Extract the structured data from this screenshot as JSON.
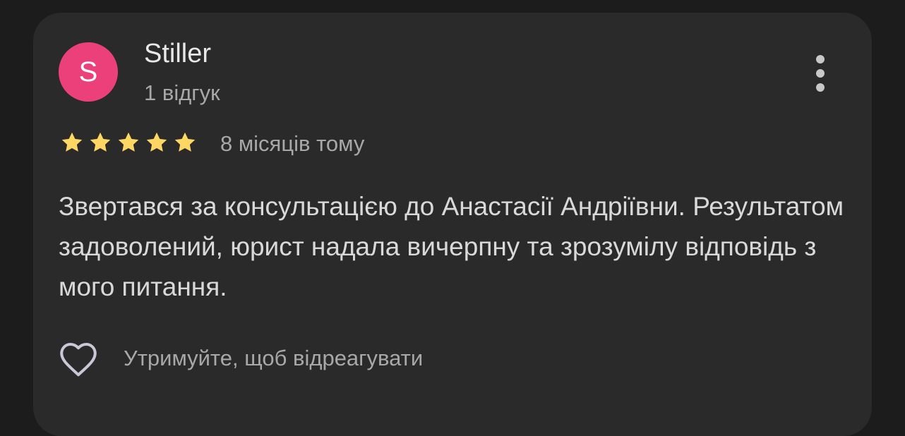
{
  "review": {
    "avatar_letter": "S",
    "author": "Stiller",
    "review_count": "1 відгук",
    "rating": 5,
    "rating_max": 5,
    "date": "8 місяців тому",
    "text": "Звертався за консультацією до Анастасії Андріївни. Результатом задоволений, юрист надала вичерпну та зрозумілу відповідь з мого питання.",
    "react_label": "Утримуйте, щоб відреагувати"
  },
  "icons": {
    "more": "more-vert-icon",
    "star": "star-icon",
    "heart": "heart-outline-icon"
  },
  "colors": {
    "background": "#1c1c1c",
    "card": "#2a2a2a",
    "avatar": "#ec407a",
    "star": "#fdd663",
    "text_primary": "#e8e8e8",
    "text_secondary": "#a8a8a8"
  }
}
